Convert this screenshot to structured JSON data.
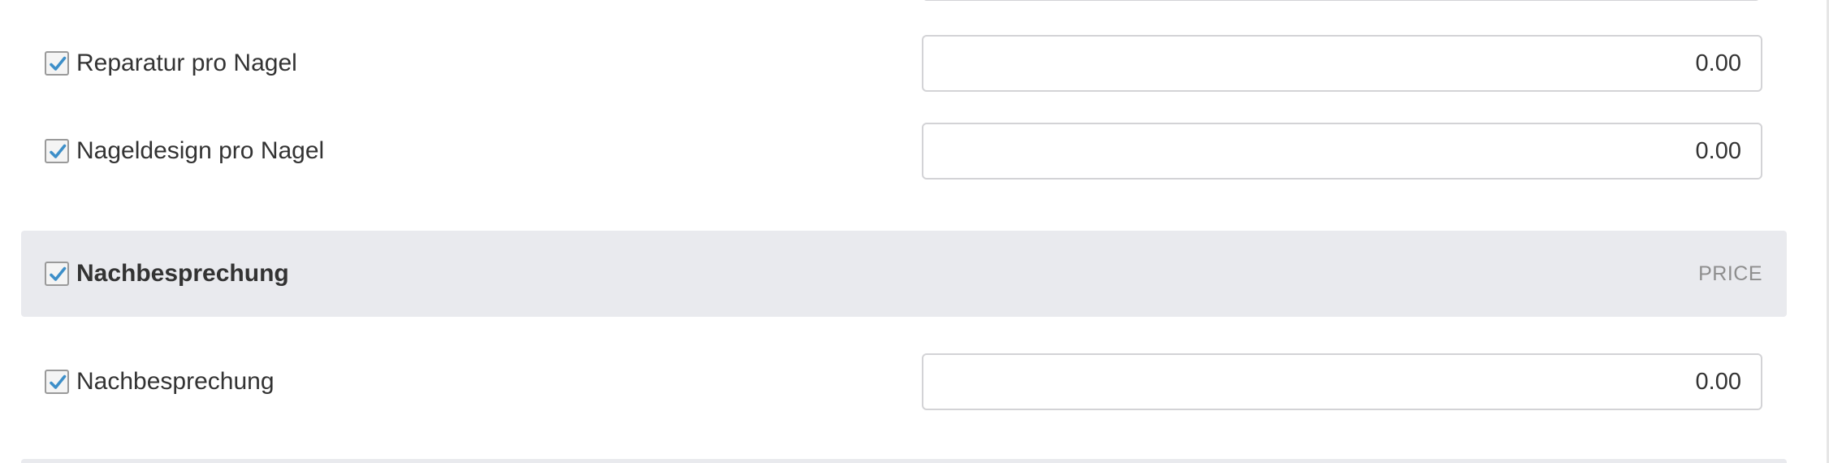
{
  "rows": [
    {
      "label": "Reparatur pro Nagel",
      "value": "0.00",
      "checked": true
    },
    {
      "label": "Nageldesign pro Nagel",
      "value": "0.00",
      "checked": true
    }
  ],
  "group": {
    "title": "Nachbesprechung",
    "price_heading": "PRICE",
    "checked": true,
    "rows": [
      {
        "label": "Nachbesprechung",
        "value": "0.00",
        "checked": true
      }
    ]
  },
  "colors": {
    "check": "#3d8fc9",
    "group_header_bg": "#e9eaee",
    "input_border": "#d3d3d6",
    "price_heading": "#8e8e8e"
  },
  "icons": {
    "checkbox": "checkmark-icon"
  }
}
